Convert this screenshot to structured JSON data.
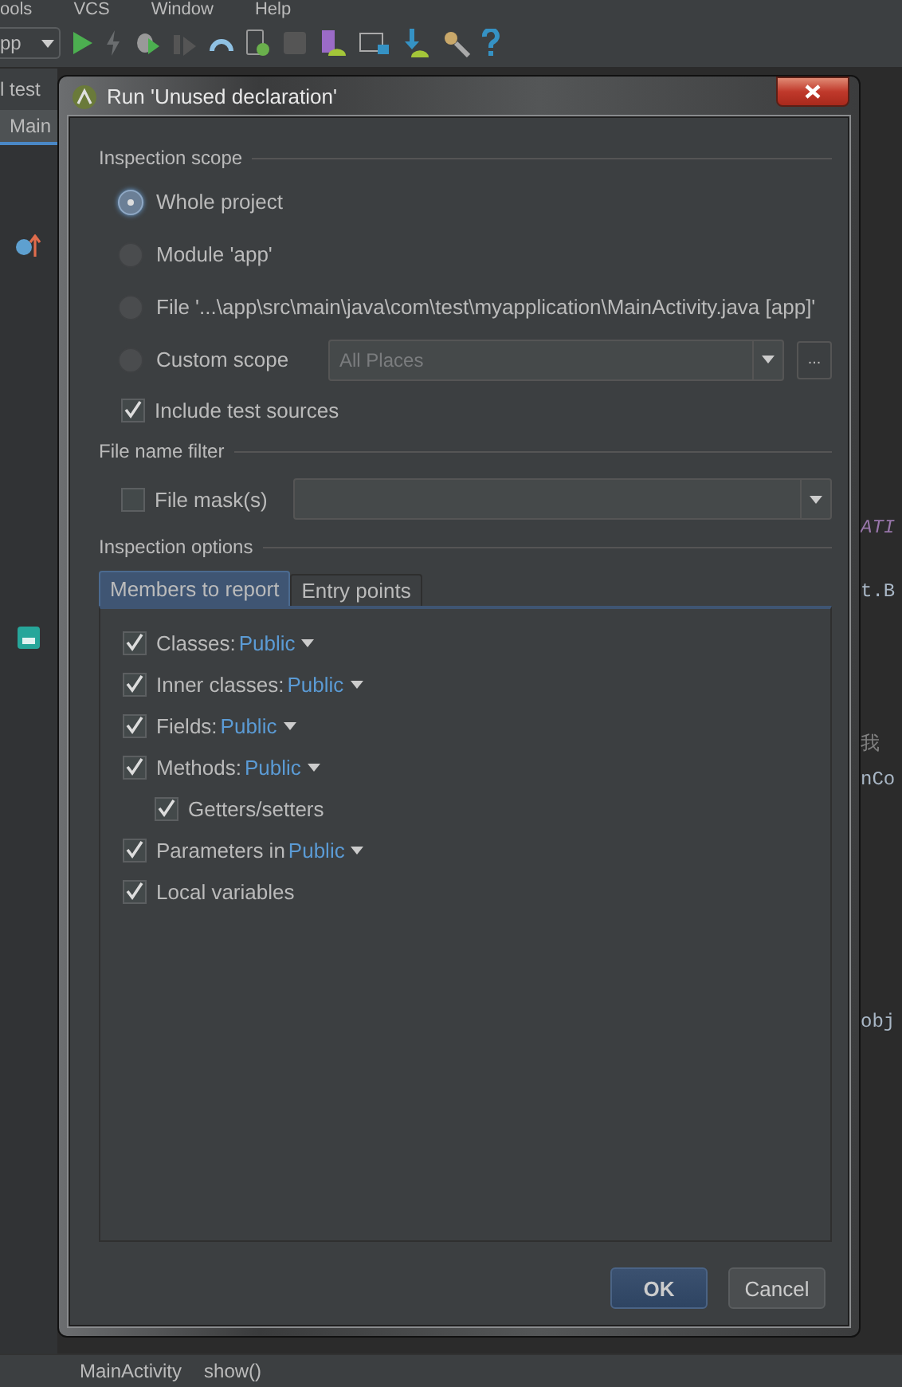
{
  "ide": {
    "menu": [
      "ools",
      "VCS",
      "Window",
      "Help"
    ],
    "run_config": "pp",
    "project_label": "l test",
    "editor_tab": "Main",
    "code_fragments": [
      {
        "text": "ATI",
        "kind": "constant"
      },
      {
        "text": "t.B",
        "kind": "code"
      },
      {
        "text": "我",
        "kind": "comment"
      },
      {
        "text": "nCo",
        "kind": "code"
      },
      {
        "text": "obj",
        "kind": "code"
      }
    ],
    "breadcrumbs": [
      "MainActivity",
      "show()"
    ]
  },
  "dialog": {
    "title": "Run 'Unused declaration'",
    "scope": {
      "heading": "Inspection scope",
      "options": [
        {
          "label": "Whole project",
          "selected": true
        },
        {
          "label": "Module 'app'",
          "selected": false
        },
        {
          "label": "File '...\\app\\src\\main\\java\\com\\test\\myapplication\\MainActivity.java [app]'",
          "selected": false
        },
        {
          "label": "Custom scope",
          "selected": false,
          "kind": "combo",
          "combo_value": "All Places",
          "more_button": "..."
        }
      ],
      "include_tests": {
        "label": "Include test sources",
        "checked": true
      }
    },
    "filter": {
      "heading": "File name filter",
      "mask": {
        "label": "File mask(s)",
        "checked": false
      }
    },
    "options": {
      "heading": "Inspection options",
      "tabs": [
        {
          "label": "Members to report",
          "selected": true
        },
        {
          "label": "Entry points",
          "selected": false
        }
      ],
      "members": [
        {
          "label": "Classes:",
          "checked": true,
          "visibility": "Public"
        },
        {
          "label": "Inner classes:",
          "checked": true,
          "visibility": "Public"
        },
        {
          "label": "Fields:",
          "checked": true,
          "visibility": "Public"
        },
        {
          "label": "Methods:",
          "checked": true,
          "visibility": "Public",
          "children": [
            {
              "label": "Getters/setters",
              "checked": true
            }
          ]
        },
        {
          "label": "Parameters in",
          "checked": true,
          "visibility": "Public"
        },
        {
          "label": "Local variables",
          "checked": true
        }
      ]
    },
    "buttons": [
      {
        "label": "OK",
        "default": true
      },
      {
        "label": "Cancel",
        "default": false
      }
    ]
  }
}
